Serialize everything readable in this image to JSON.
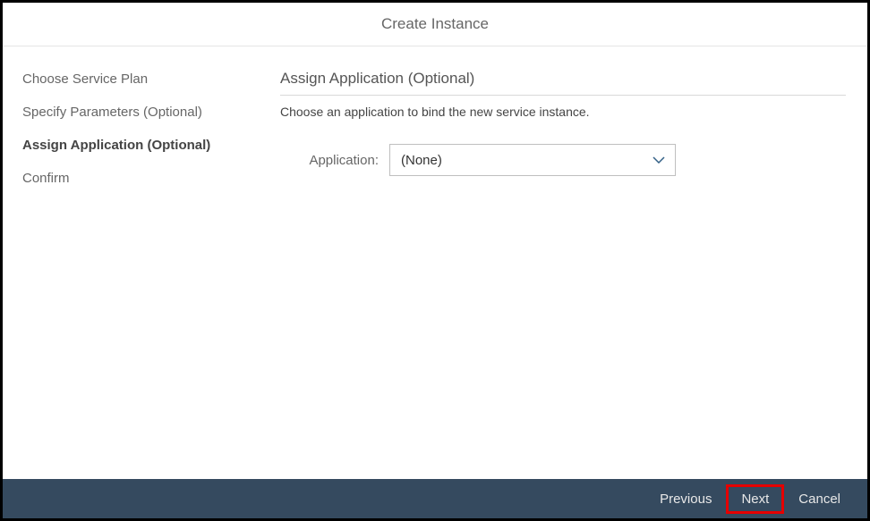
{
  "header": {
    "title": "Create Instance"
  },
  "sidebar": {
    "items": [
      {
        "label": "Choose Service Plan"
      },
      {
        "label": "Specify Parameters (Optional)"
      },
      {
        "label": "Assign Application (Optional)"
      },
      {
        "label": "Confirm"
      }
    ],
    "activeIndex": 2
  },
  "content": {
    "title": "Assign Application (Optional)",
    "description": "Choose an application to bind the new service instance.",
    "field": {
      "label": "Application:",
      "value": "(None)"
    }
  },
  "footer": {
    "previous": "Previous",
    "next": "Next",
    "cancel": "Cancel"
  }
}
